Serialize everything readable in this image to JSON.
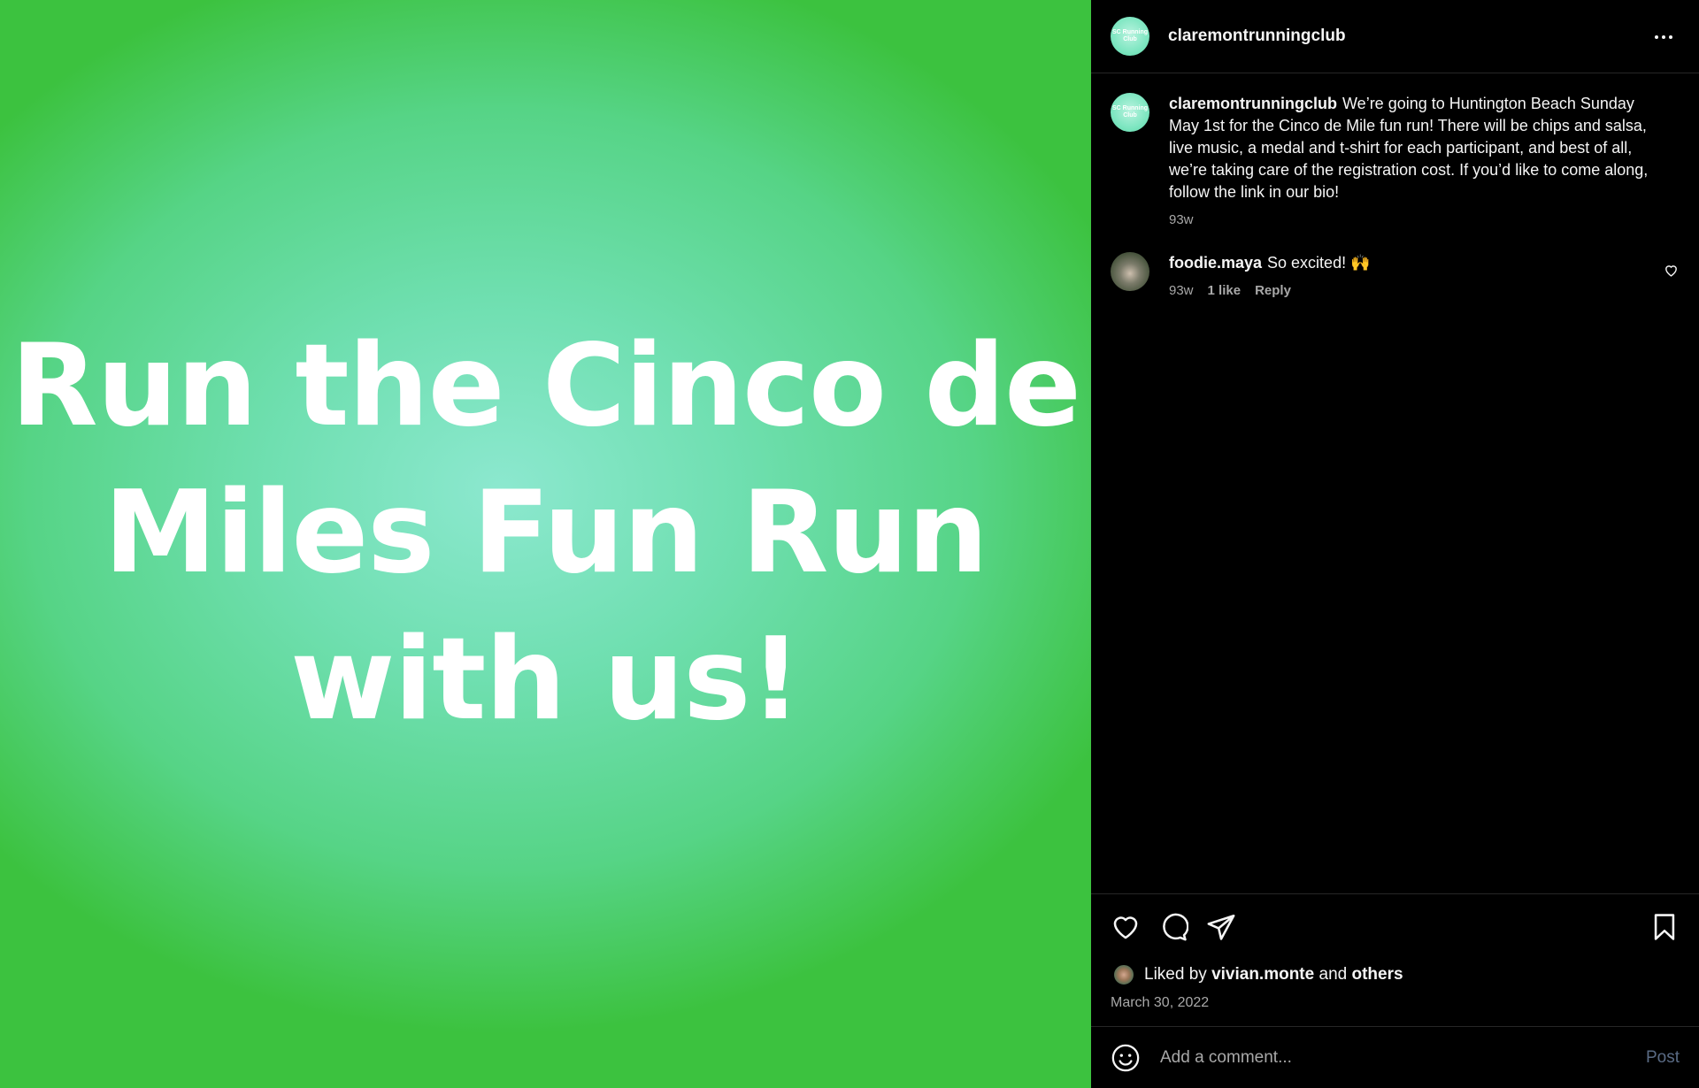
{
  "post_image": {
    "headline": "Run the Cinco de Miles Fun Run with us!",
    "colors": {
      "edge": "#3cc23f",
      "center": "#8ce8cf"
    }
  },
  "header": {
    "avatar_text": "SC Running Club",
    "username": "claremontrunningclub"
  },
  "caption": {
    "username": "claremontrunningclub",
    "text": "We’re going to Huntington Beach Sunday May 1st for the Cinco de Mile fun run! There will be chips and salsa, live music, a medal and t-shirt for each participant, and best of all, we’re taking care of the registration cost. If you’d like to come along, follow the link in our bio!",
    "age": "93w"
  },
  "comments": [
    {
      "username": "foodie.maya",
      "text": "So excited! 🙌",
      "age": "93w",
      "likes": "1 like",
      "reply_label": "Reply"
    }
  ],
  "likes": {
    "prefix": "Liked by",
    "user": "vivian.monte",
    "joiner": "and",
    "others": "others"
  },
  "post_date": "March 30, 2022",
  "comment_box": {
    "placeholder": "Add a comment...",
    "post_label": "Post"
  },
  "icons": [
    "more-icon",
    "heart-icon",
    "comment-icon",
    "share-icon",
    "bookmark-icon",
    "emoji-icon"
  ]
}
